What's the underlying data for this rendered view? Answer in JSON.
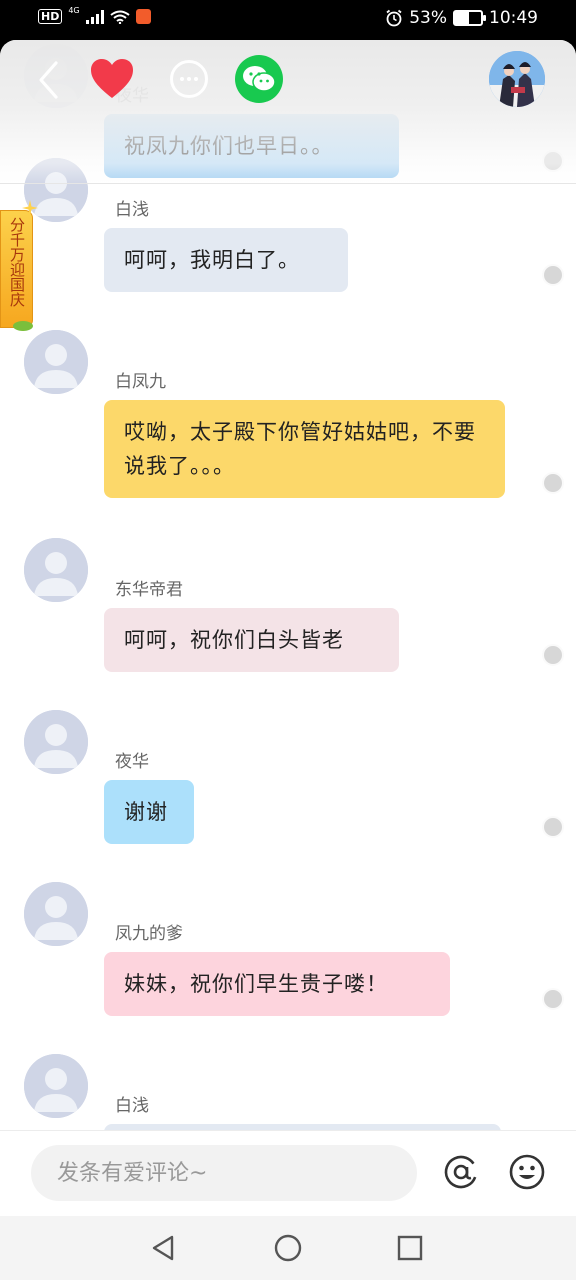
{
  "status_bar": {
    "hd": "HD",
    "network": "4G",
    "battery_percent": "53%",
    "battery_level": 0.53,
    "time": "10:49"
  },
  "topbar": {
    "back_icon": "chevron-left-icon",
    "like_icon": "heart-icon",
    "more_icon": "more-icon",
    "share_icon": "wechat-icon",
    "like_color": "#f23a4a",
    "wechat_color": "#18c94f"
  },
  "promo": {
    "text": "分千万迎国庆"
  },
  "messages": [
    {
      "sender": "夜华",
      "text": "祝凤九你们也早日。。",
      "bubble_color": "#a9d3f3"
    },
    {
      "sender": "白浅",
      "text": "呵呵，我明白了。",
      "bubble_color": "#e3e9f2"
    },
    {
      "sender": "白凤九",
      "text": "哎呦，太子殿下你管好姑姑吧，不要说我了。。。",
      "bubble_color": "#fcd86a"
    },
    {
      "sender": "东华帝君",
      "text": "呵呵，祝你们白头皆老",
      "bubble_color": "#f4e3e7"
    },
    {
      "sender": "夜华",
      "text": "谢谢",
      "bubble_color": "#ace0fb"
    },
    {
      "sender": "凤九的爹",
      "text": "妹妹，祝你们早生贵子喽！",
      "bubble_color": "#fdd4dd"
    },
    {
      "sender": "白浅",
      "text": "",
      "bubble_color": "#e3e9f2"
    }
  ],
  "input": {
    "placeholder": "发条有爱评论~",
    "value": ""
  },
  "nav": {
    "back": "nav-back-icon",
    "home": "nav-home-icon",
    "recent": "nav-recent-icon"
  }
}
